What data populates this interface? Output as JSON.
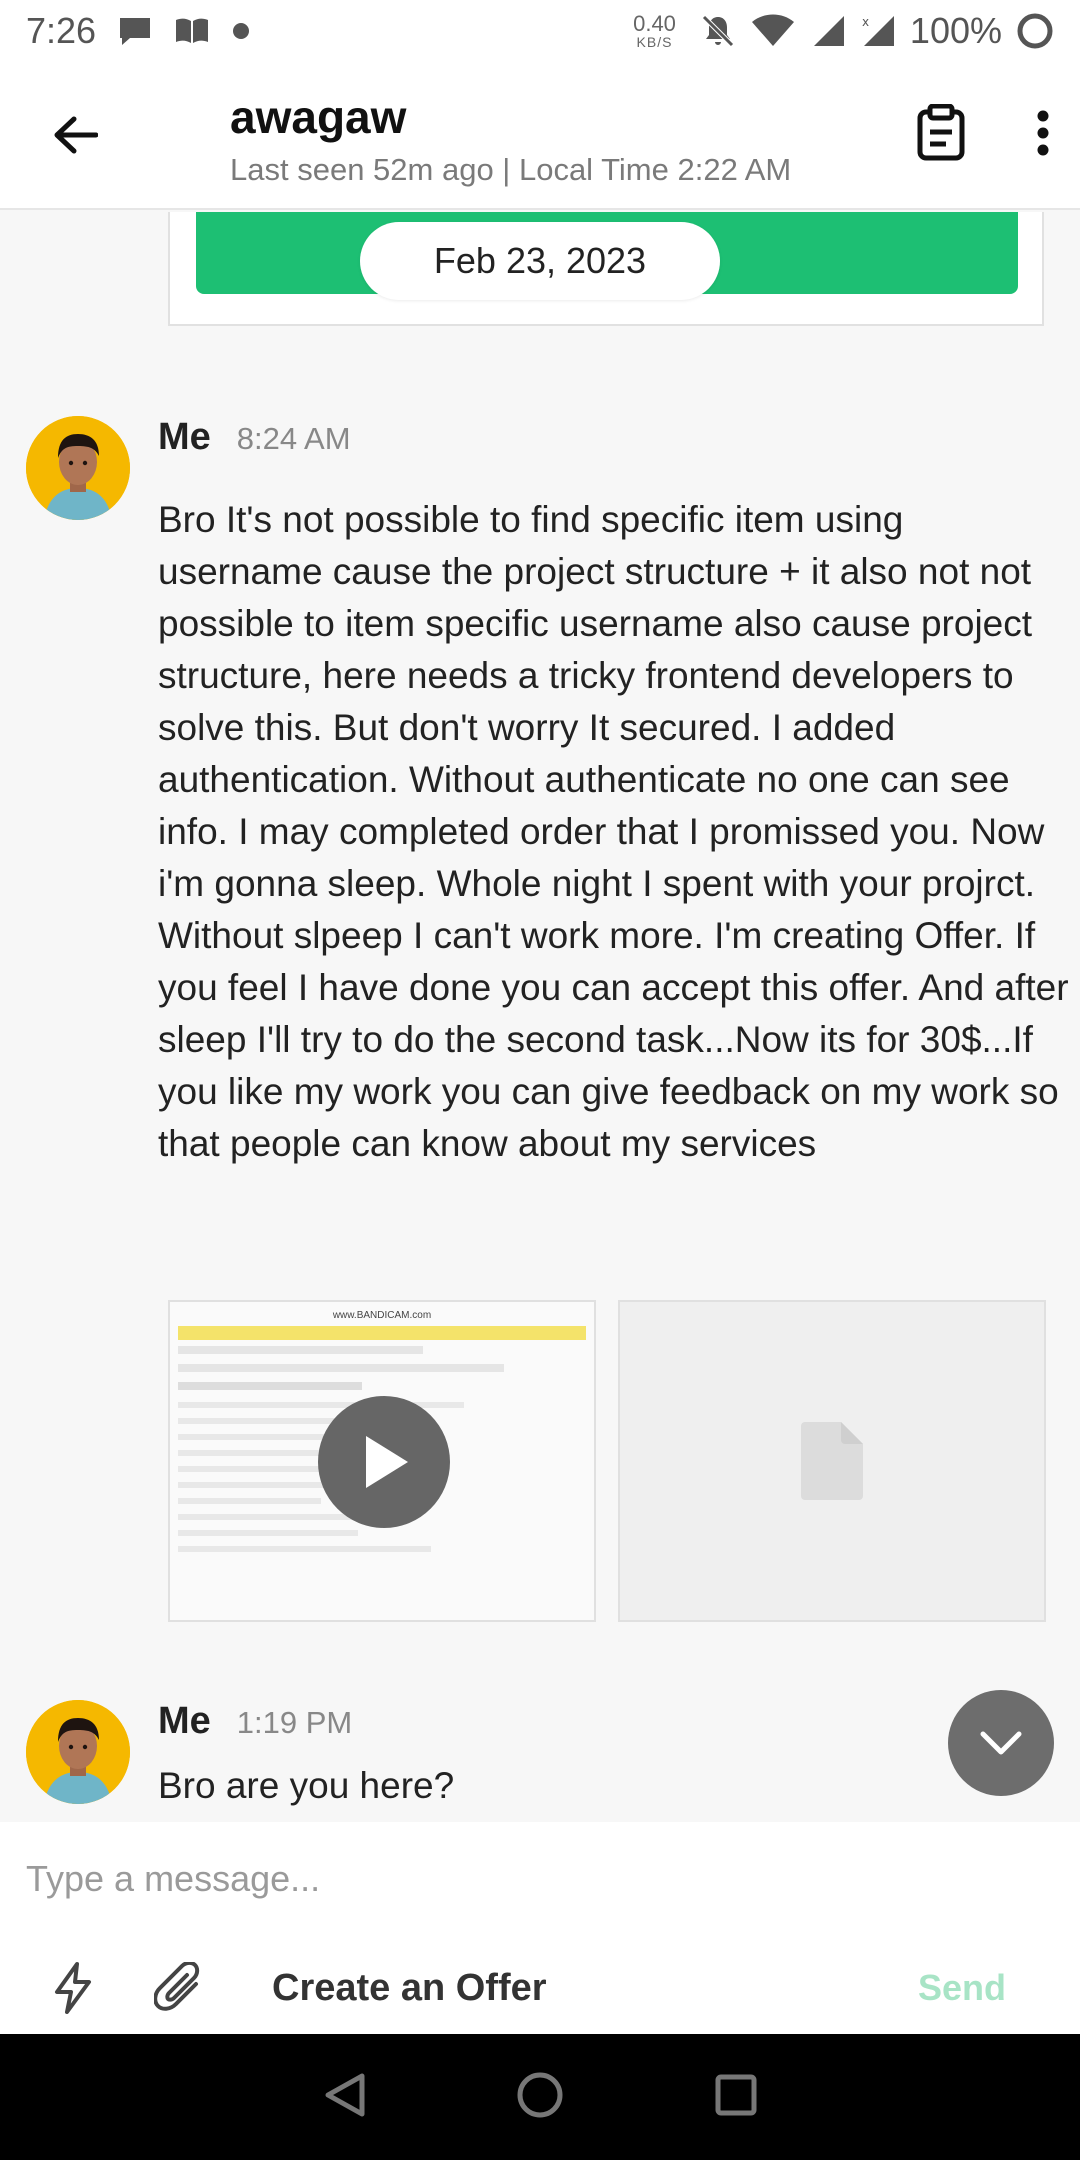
{
  "status_bar": {
    "time": "7:26",
    "net_speed": "0.40",
    "net_unit": "KB/S",
    "battery": "100%"
  },
  "header": {
    "name": "awagaw",
    "subtitle": "Last seen 52m ago | Local Time 2:22 AM"
  },
  "thread": {
    "date_pill": "Feb 23, 2023",
    "messages": [
      {
        "sender": "Me",
        "time": "8:24 AM",
        "text": "Bro It's not possible to find specific item using username cause the project structure + it also not not possible to item specific username also cause project structure, here needs a tricky frontend developers to solve this. But don't worry It secured. I added authentication. Without authenticate no one can see info. I may completed order that I promissed you. Now i'm gonna sleep. Whole night I spent with your projrct. Without slpeep I can't work more. I'm creating Offer. If you feel I have done you can accept this offer. And after sleep I'll try to do the second task...Now its for 30$...If you like my work you can give feedback on my work so that people can know about my services"
      },
      {
        "sender": "Me",
        "time": "1:19 PM",
        "text": "Bro are you here?"
      }
    ],
    "attachment_watermark": "www.BANDICAM.com"
  },
  "composer": {
    "placeholder": "Type a message...",
    "create_offer_label": "Create an Offer",
    "send_label": "Send"
  },
  "colors": {
    "accent_green": "#1dbf73",
    "send_disabled": "#a8e4c6"
  }
}
